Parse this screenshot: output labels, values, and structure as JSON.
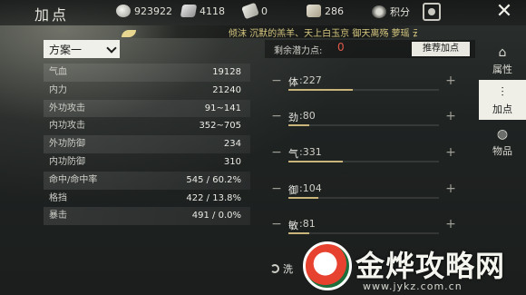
{
  "header": {
    "title": "加点",
    "resources": [
      {
        "icon": "coin-icon",
        "value": "923922"
      },
      {
        "icon": "silver-icon",
        "value": "4118"
      },
      {
        "icon": "ticket-icon",
        "value": "0"
      },
      {
        "icon": "scroll-icon",
        "value": "286"
      },
      {
        "icon": "points-icon",
        "value": "积分"
      }
    ],
    "close": "✕"
  },
  "chat_marquee": "倾沫 沉默的羔羊、天上白玉京 御天离殇 萝瑶 云水谣",
  "stats": {
    "scheme": "方案一",
    "rows": [
      {
        "label": "气血",
        "value": "19128"
      },
      {
        "label": "内力",
        "value": "21240"
      },
      {
        "label": "外功攻击",
        "value": "91~141"
      },
      {
        "label": "内功攻击",
        "value": "352~705"
      },
      {
        "label": "外功防御",
        "value": "234"
      },
      {
        "label": "内功防御",
        "value": "310"
      },
      {
        "label": "命中/命中率",
        "value": "545 / 60.2%"
      },
      {
        "label": "格挡",
        "value": "422 / 13.8%"
      },
      {
        "label": "暴击",
        "value": "491 / 0.0%"
      }
    ]
  },
  "attributes": {
    "remaining_label": "剩余潜力点:",
    "remaining_value": "0",
    "recommend_button": "推荐加点",
    "wash_button": "洗",
    "minus": "−",
    "plus": "+",
    "rows": [
      {
        "name": "体",
        "value": ":227",
        "fill": 0.43
      },
      {
        "name": "劲",
        "value": ":80",
        "fill": 0.14
      },
      {
        "name": "气",
        "value": ":331",
        "fill": 0.36
      },
      {
        "name": "御",
        "value": ":104",
        "fill": 0.2
      },
      {
        "name": "敏",
        "value": ":81",
        "fill": 0.14
      }
    ]
  },
  "tabs": [
    {
      "label": "属性",
      "icon": "pagoda-icon",
      "glyph": "⌂"
    },
    {
      "label": "加点",
      "icon": "sliders-icon",
      "glyph": "⫶"
    },
    {
      "label": "物品",
      "icon": "bag-icon",
      "glyph": "◍"
    }
  ],
  "watermark": {
    "name": "金烨攻略网",
    "url": "www.jykz.com.cn"
  },
  "colors": {
    "accent_red": "#e05a4a",
    "bar_gold": "#c9b47a"
  }
}
